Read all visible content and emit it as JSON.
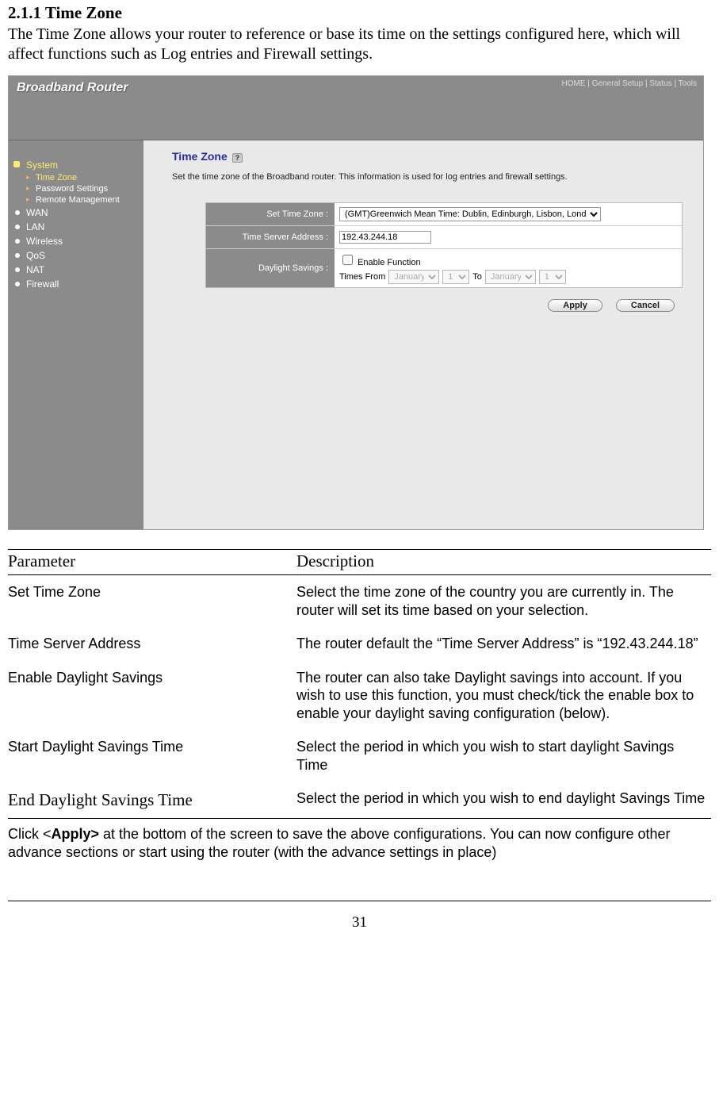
{
  "section": {
    "heading": "2.1.1 Time Zone",
    "intro": "The Time Zone allows your router to reference or base its time on the settings configured here, which will affect functions such as Log entries and Firewall settings."
  },
  "router": {
    "brand": "Broadband Router",
    "topnav": "HOME | General Setup | Status | Tools",
    "sidebar": {
      "system": "System",
      "sub": {
        "tz": "Time Zone",
        "pw": "Password Settings",
        "rm": "Remote Management"
      },
      "wan": "WAN",
      "lan": "LAN",
      "wireless": "Wireless",
      "qos": "QoS",
      "nat": "NAT",
      "firewall": "Firewall"
    },
    "main": {
      "title": "Time Zone",
      "help": "?",
      "desc": "Set the time zone of the Broadband router. This information is used for log entries and firewall settings.",
      "labels": {
        "stz": "Set Time Zone :",
        "tsa": "Time Server Address :",
        "ds": "Daylight Savings :"
      },
      "values": {
        "tz_option": "(GMT)Greenwich Mean Time: Dublin, Edinburgh, Lisbon, London",
        "ts_addr": "192.43.244.18",
        "enable_label": "Enable Function",
        "times_from": "Times From",
        "to": "To",
        "month": "January",
        "day": "1"
      },
      "buttons": {
        "apply": "Apply",
        "cancel": "Cancel"
      }
    }
  },
  "table": {
    "head": {
      "p": "Parameter",
      "d": "Description"
    },
    "rows": [
      {
        "p": "Set Time Zone",
        "d": "Select the time zone of the country you are currently in. The router will set its time based on your selection."
      },
      {
        "p": "Time Server Address",
        "d": "The router default the “Time Server Address” is “192.43.244.18”"
      },
      {
        "p": "Enable Daylight Savings",
        "d": "The router can also take Daylight savings into account. If you wish to use this function, you must check/tick the enable box to enable your daylight saving configuration (below)."
      },
      {
        "p": "Start Daylight Savings Time",
        "d": "Select the period in which you wish to start daylight Savings Time"
      },
      {
        "p": "End Daylight Savings Time",
        "d": "Select the period in which you wish to end daylight Savings Time"
      }
    ]
  },
  "after": {
    "pre": "Click <",
    "bold": "Apply>",
    "post": " at the bottom of the screen to save the above configurations. You can now configure other advance sections or start using the router (with the advance settings in place)"
  },
  "page": "31"
}
